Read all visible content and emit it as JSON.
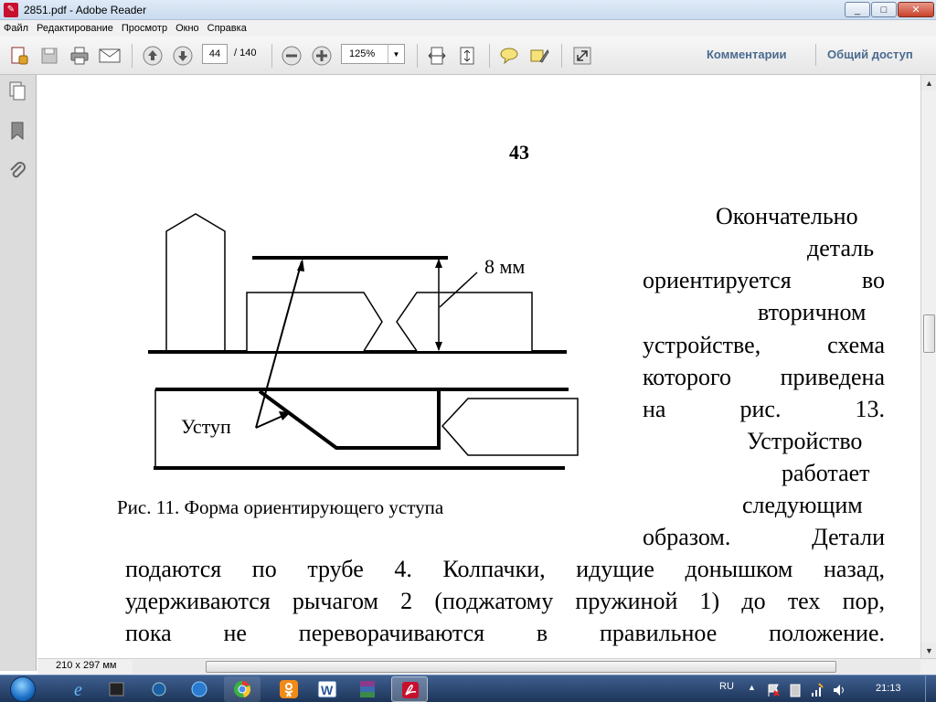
{
  "window": {
    "title": "2851.pdf - Adobe Reader",
    "app_icon": "adobe-reader-icon"
  },
  "window_buttons": {
    "minimize": "_",
    "maximize": "□",
    "close": "✕"
  },
  "menu": [
    "Файл",
    "Редактирование",
    "Просмотр",
    "Окно",
    "Справка"
  ],
  "toolbar": {
    "current_page": "44",
    "total_pages": "/ 140",
    "zoom": "125%",
    "comments_label": "Комментарии",
    "share_label": "Общий доступ"
  },
  "document": {
    "page_number": "43",
    "right_column_lines": [
      "Окончательно",
      "деталь",
      "ориентируется во",
      "вторичном",
      "устройстве, схема",
      "которого приведена",
      "на рис. 13.",
      "Устройство",
      "работает",
      "следующим",
      "образом. Детали"
    ],
    "full_lines": [
      "подаются по трубе 4. Колпачки, идущие донышком назад,",
      "удерживаются рычагом 2 (поджатому пружиной 1) до тех пор,",
      "пока не переворачиваются в правильное положение."
    ],
    "figure": {
      "label_dimension": "8 мм",
      "label_step": "Уступ",
      "caption": "Рис. 11. Форма ориентирующего уступа"
    }
  },
  "status": {
    "page_size": "210 x 297 мм"
  },
  "taskbar": {
    "language": "RU",
    "clock": "21:13"
  }
}
